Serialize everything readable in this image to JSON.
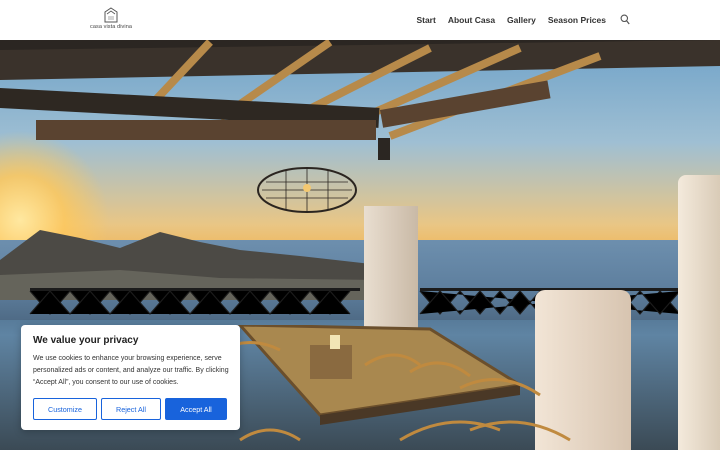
{
  "logo": {
    "text": "casa vista divina",
    "icon": "house-icon"
  },
  "nav": {
    "items": [
      {
        "label": "Start"
      },
      {
        "label": "About Casa"
      },
      {
        "label": "Gallery"
      },
      {
        "label": "Season Prices"
      }
    ],
    "search_icon": "search-icon"
  },
  "hero": {
    "image_description": ""
  },
  "cookie_banner": {
    "title": "We value your privacy",
    "text": "We use cookies to enhance your browsing experience, serve personalized ads or content, and analyze our traffic. By clicking “Accept All”, you consent to our use of cookies.",
    "buttons": {
      "customize": "Customize",
      "reject": "Reject All",
      "accept": "Accept All"
    },
    "accent_color": "#1863dc"
  }
}
